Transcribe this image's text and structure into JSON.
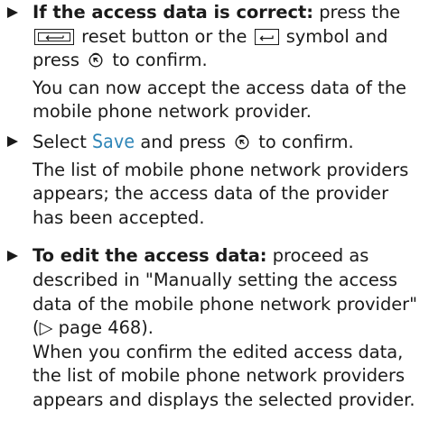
{
  "bullets": [
    {
      "lead": "If the access data is correct:",
      "t1": " press the",
      "reset_key_icon": "reset-key-icon",
      "t2": " reset button or the ",
      "back_symbol_icon": "back-arrow-icon",
      "t3": " symbol and press ",
      "confirm_icon": "controller-press-icon",
      "t4": " to confirm.",
      "result": "You can now accept the access data of the mobile phone network provider."
    },
    {
      "t1": "Select ",
      "term": "Save",
      "t2": " and press ",
      "confirm_icon": "controller-press-icon",
      "t3": " to confirm.",
      "result": "The list of mobile phone network providers appears; the access data of the provider has been accepted."
    },
    {
      "lead": "To edit the access data:",
      "t1": " proceed as described in \"Manually setting the access data of the mobile phone network provider\" (▷ page 468).",
      "result": "When you confirm the edited access data, the list of mobile phone network providers appears and displays the selected provider."
    }
  ],
  "colors": {
    "text": "#1a1a1a",
    "ui_term": "#2f86b8"
  }
}
